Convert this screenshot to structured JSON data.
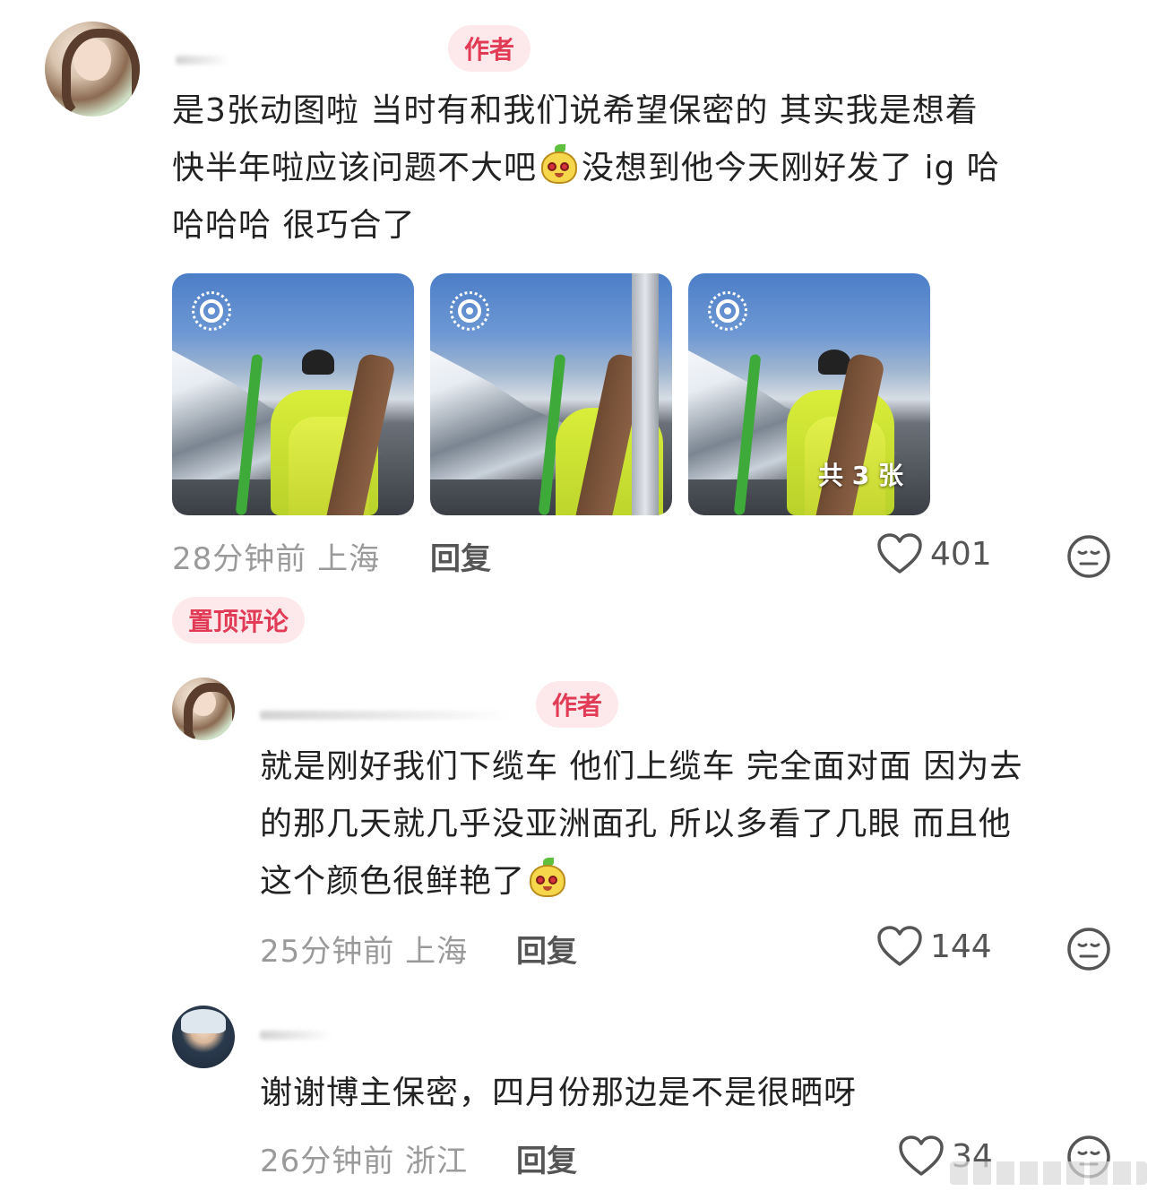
{
  "comments": [
    {
      "badge": "作者",
      "text_lines": [
        "是3张动图啦 当时有和我们说希望保密的 其实我是想着",
        "快半年啦应该问题不大吧",
        "没想到他今天刚好发了 ig 哈",
        "哈哈哈 很巧合了"
      ],
      "photos_count_label": "共 3 张",
      "time_location": "28分钟前 上海",
      "reply_label": "回复",
      "likes": "401"
    },
    {
      "pinned_label": "置顶评论",
      "badge": "作者",
      "text_lines": [
        "就是刚好我们下缆车 他们上缆车 完全面对面 因为去",
        "的那几天就几乎没亚洲面孔 所以多看了几眼 而且他",
        "这个颜色很鲜艳了"
      ],
      "time_location": "25分钟前 上海",
      "reply_label": "回复",
      "likes": "144"
    },
    {
      "text_lines": [
        "谢谢博主保密，四月份那边是不是很晒呀"
      ],
      "time_location": "26分钟前 浙江",
      "reply_label": "回复",
      "likes": "34"
    }
  ],
  "colors": {
    "badge_bg": "#fde9ec",
    "badge_text": "#e23b55",
    "meta_text": "#9a9a9a"
  }
}
